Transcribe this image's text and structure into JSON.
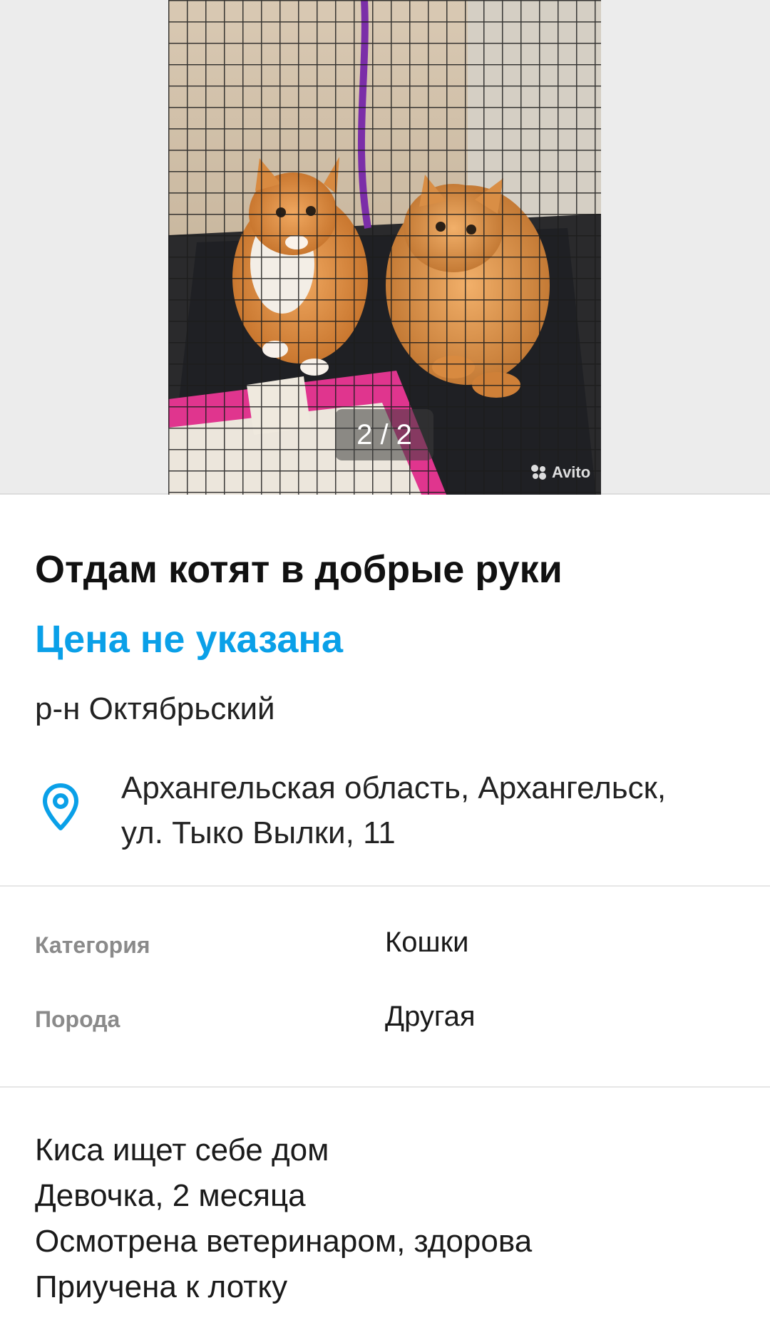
{
  "gallery": {
    "counter": "2 / 2",
    "watermark": "Avito",
    "photo_alt": "kittens-photo"
  },
  "listing": {
    "title": "Отдам котят в добрые руки",
    "price": "Цена не указана",
    "district": "р-н Октябрьский",
    "address_line1": "Архангельская область, Архангельск,",
    "address_line2": "ул. Тыко Вылки, 11"
  },
  "params": [
    {
      "key": "Категория",
      "value": "Кошки"
    },
    {
      "key": "Порода",
      "value": "Другая"
    }
  ],
  "description": [
    "Киса ищет себе дом",
    "Девочка, 2 месяца",
    "Осмотрена ветеринаром, здорова",
    "Приучена к лотку"
  ],
  "colors": {
    "accent": "#0aa0e8",
    "muted": "#8a8a8a"
  },
  "icons": {
    "location": "location-pin-icon"
  }
}
